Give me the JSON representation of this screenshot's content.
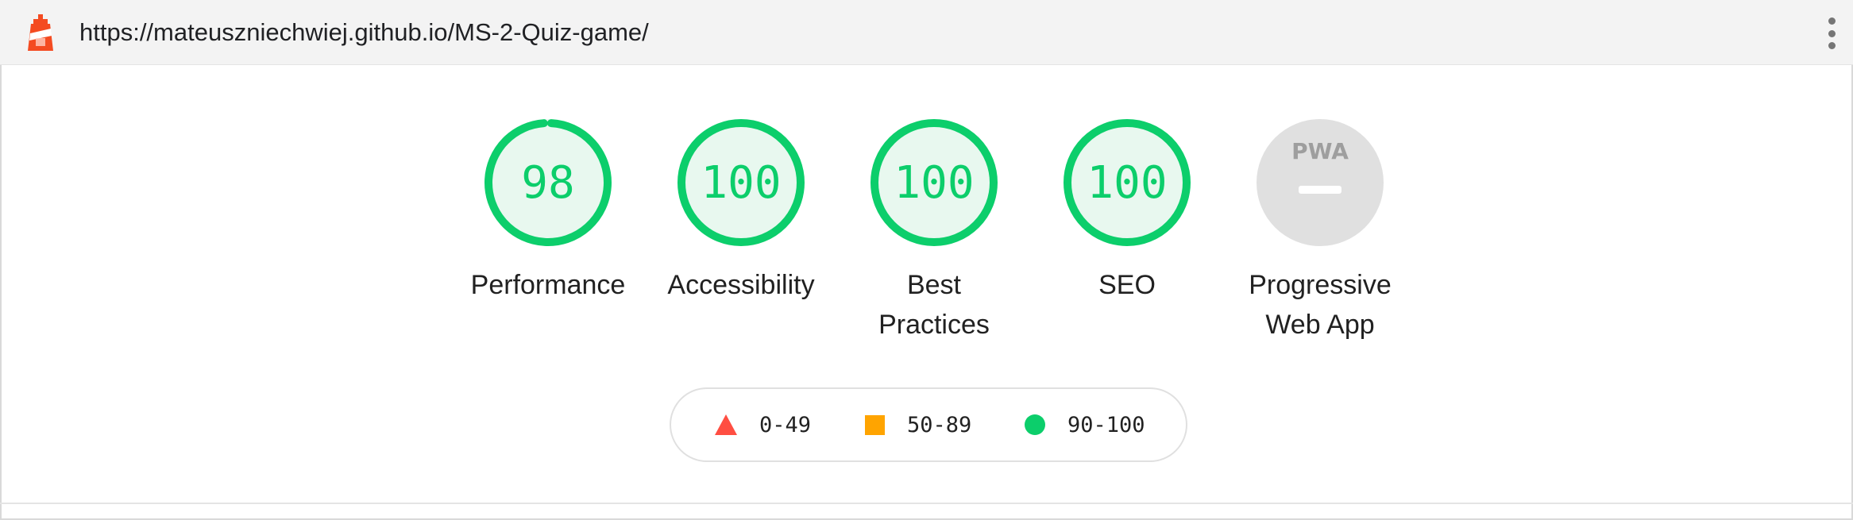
{
  "header": {
    "url": "https://mateuszniechwiej.github.io/MS-2-Quiz-game/",
    "logo_icon": "lighthouse-icon",
    "menu_icon": "more-vertical-icon"
  },
  "gauges": [
    {
      "score": "98",
      "score_value": 98,
      "label_lines": [
        "Performance"
      ],
      "color": "#0cce6b"
    },
    {
      "score": "100",
      "score_value": 100,
      "label_lines": [
        "Accessibility"
      ],
      "color": "#0cce6b"
    },
    {
      "score": "100",
      "score_value": 100,
      "label_lines": [
        "Best",
        "Practices"
      ],
      "color": "#0cce6b"
    },
    {
      "score": "100",
      "score_value": 100,
      "label_lines": [
        "SEO"
      ],
      "color": "#0cce6b"
    },
    {
      "score": "PWA",
      "score_value": null,
      "label_lines": [
        "Progressive",
        "Web App"
      ],
      "color": "#9e9e9e",
      "icon": "pwa-icon"
    }
  ],
  "legend": [
    {
      "label": "0-49",
      "icon": "triangle-icon",
      "color": "#ff4e42"
    },
    {
      "label": "50-89",
      "icon": "square-icon",
      "color": "#ffa400"
    },
    {
      "label": "90-100",
      "icon": "circle-icon",
      "color": "#0cce6b"
    }
  ],
  "colors": {
    "pass": "#0cce6b",
    "pass_bg": "#e8f8ef",
    "average": "#ffa400",
    "fail": "#ff4e42",
    "pwa_bg": "#e0e0e0"
  }
}
